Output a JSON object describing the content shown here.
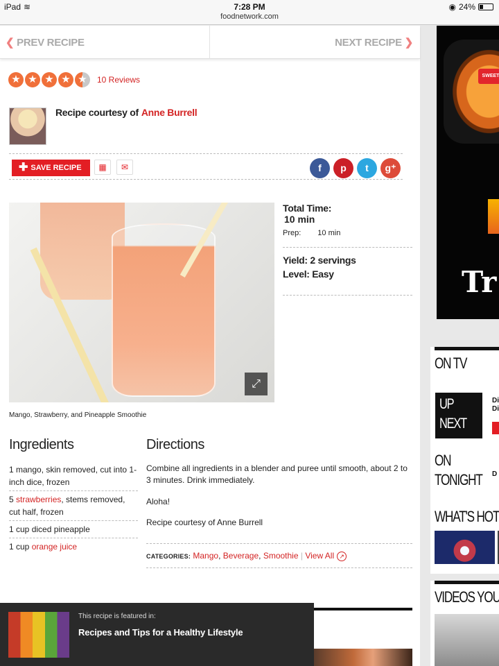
{
  "device": {
    "name": "iPad",
    "time": "7:28 PM",
    "battery": "24%",
    "url": "foodnetwork.com"
  },
  "nav": {
    "prev": "PREV RECIPE",
    "next": "NEXT RECIPE"
  },
  "rating": {
    "stars": 4.5,
    "reviews": "10 Reviews"
  },
  "author": {
    "prefix": "Recipe courtesy of",
    "name": "Anne Burrell"
  },
  "tools": {
    "save": "SAVE RECIPE",
    "print_icon": "print-icon",
    "email_icon": "email-icon",
    "social": [
      {
        "icon": "facebook-icon",
        "glyph": "f",
        "color": "#3b5998"
      },
      {
        "icon": "pinterest-icon",
        "glyph": "p",
        "color": "#cb2027"
      },
      {
        "icon": "twitter-icon",
        "glyph": "t",
        "color": "#2ca7e0"
      },
      {
        "icon": "googleplus-icon",
        "glyph": "g⁺",
        "color": "#dd4b39"
      }
    ]
  },
  "photo": {
    "caption": "Mango, Strawberry, and Pineapple Smoothie"
  },
  "info": {
    "total_label": "Total Time:",
    "total_value": "10 min",
    "prep_label": "Prep:",
    "prep_value": "10 min",
    "yield_label": "Yield:",
    "yield_value": "2 servings",
    "level_label": "Level:",
    "level_value": "Easy"
  },
  "ingredients": {
    "title": "Ingredients",
    "items": [
      {
        "pre": "1 mango, skin removed, cut into 1-inch dice, frozen",
        "link": "",
        "post": ""
      },
      {
        "pre": "5 ",
        "link": "strawberries",
        "post": ", stems removed, cut half, frozen"
      },
      {
        "pre": "1 cup diced pineapple",
        "link": "",
        "post": ""
      },
      {
        "pre": "1 cup ",
        "link": "orange juice",
        "post": ""
      }
    ]
  },
  "directions": {
    "title": "Directions",
    "steps": [
      "Combine all ingredients in a blender and puree until smooth, about 2 to 3 minutes. Drink immediately.",
      "Aloha!",
      "Recipe courtesy of Anne Burrell"
    ],
    "categories_label": "CATEGORIES:",
    "categories": [
      "Mango",
      "Beverage",
      "Smoothie"
    ],
    "view_all": "View All"
  },
  "featured": {
    "kicker": "This recipe is featured in:",
    "title": "Recipes and Tips for a Healthy Lifestyle"
  },
  "sidebar": {
    "ad_label": "SWEET",
    "ad_text": "Tr",
    "on_tv": "ON TV",
    "up_next_1": "UP",
    "up_next_2": "NEXT",
    "up_next_side": "Di\nDi",
    "on_tonight_1": "ON",
    "on_tonight_2": "TONIGHT",
    "on_tonight_side": "D",
    "whats_hot": "WHAT'S HOT",
    "videos": "VIDEOS YOU'L"
  },
  "colors": {
    "accent": "#d32323",
    "save_button": "#e31e24",
    "star": "#f0703a"
  }
}
